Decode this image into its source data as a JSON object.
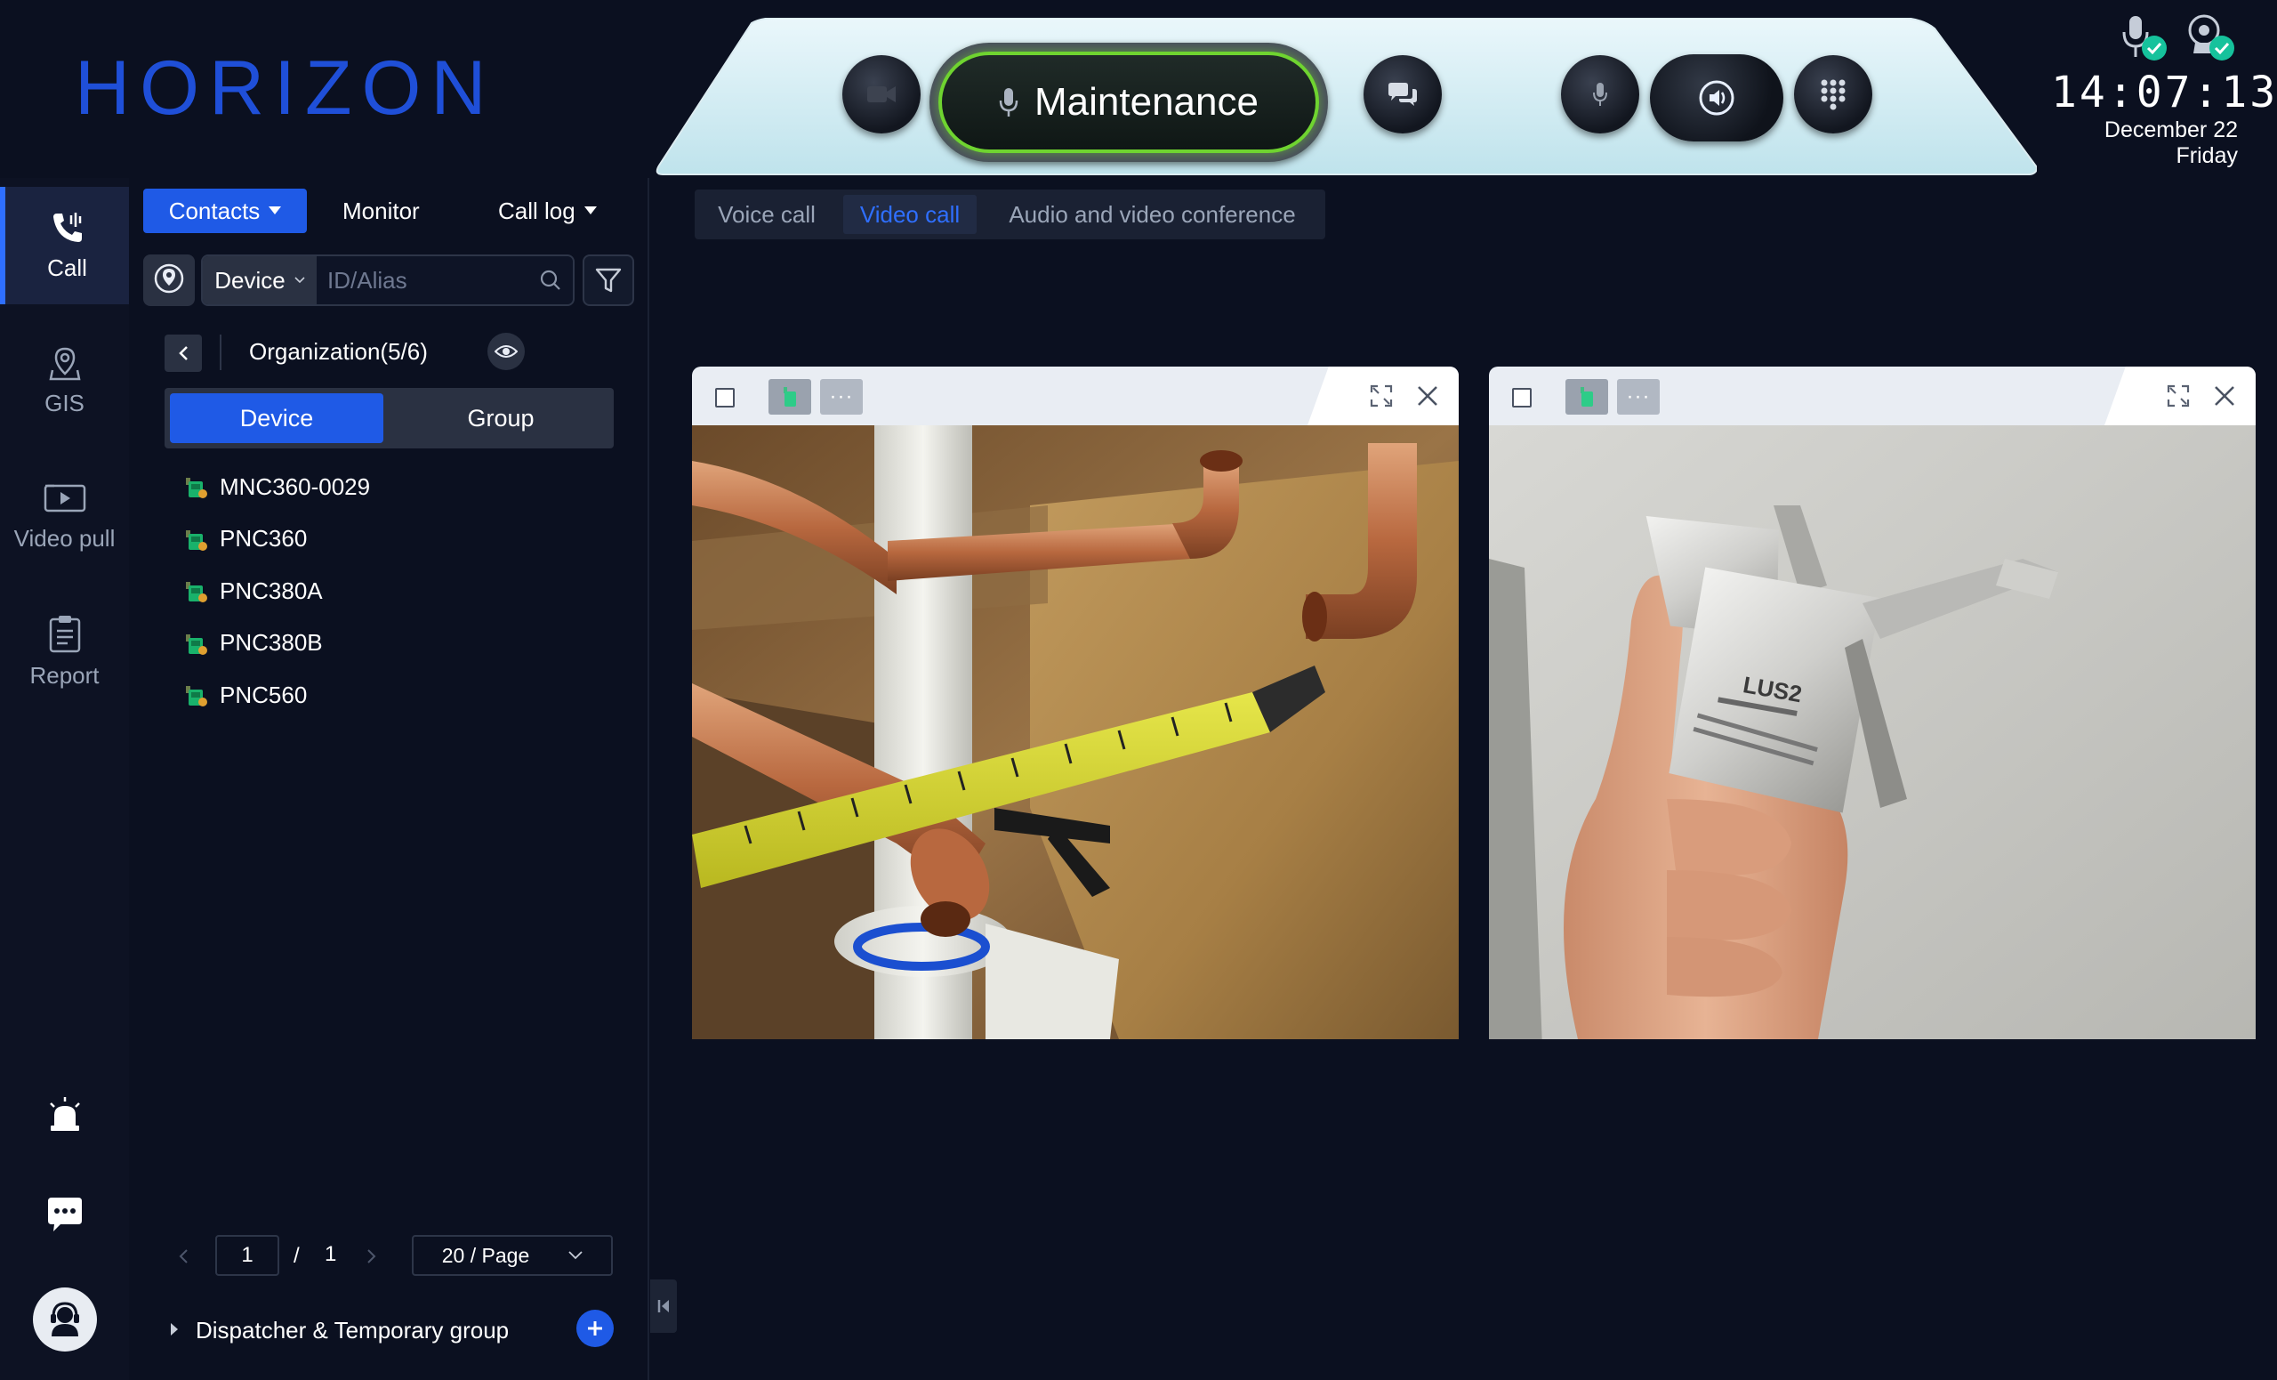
{
  "header": {
    "logo": "HORIZON",
    "ptt_label": "Maintenance",
    "clock": "14:07:13",
    "date": "December 22",
    "weekday": "Friday"
  },
  "nav": {
    "items": [
      {
        "label": "Call",
        "icon": "phone-wave-icon",
        "active": true
      },
      {
        "label": "GIS",
        "icon": "map-pin-icon",
        "active": false
      },
      {
        "label": "Video pull",
        "icon": "video-play-icon",
        "active": false
      },
      {
        "label": "Report",
        "icon": "clipboard-icon",
        "active": false
      }
    ],
    "bottom_icons": [
      "alarm-light-icon",
      "chat-bubble-icon",
      "headset-user-icon"
    ]
  },
  "panel": {
    "tabs": {
      "contacts": "Contacts",
      "monitor": "Monitor",
      "call_log": "Call log"
    },
    "search": {
      "scope": "Device",
      "placeholder": "ID/Alias"
    },
    "org_label": "Organization(5/6)",
    "segment": {
      "device": "Device",
      "group": "Group"
    },
    "devices": [
      "MNC360-0029",
      "PNC360",
      "PNC380A",
      "PNC380B",
      "PNC560"
    ],
    "pager": {
      "current": "1",
      "separator": "/",
      "total": "1",
      "page_size": "20 / Page"
    },
    "dispatcher_label": "Dispatcher & Temporary group"
  },
  "main": {
    "call_tabs": [
      {
        "label": "Voice call",
        "active": false
      },
      {
        "label": "Video call",
        "active": true
      },
      {
        "label": "Audio and video conference",
        "active": false
      }
    ],
    "video_windows": [
      {
        "content": "copper-pipes-and-tape-measure"
      },
      {
        "content": "hand-holding-metal-bracket"
      }
    ]
  },
  "colors": {
    "accent": "#1f5ae6",
    "ptt_ring": "#6fd430",
    "background": "#0b1020",
    "active_tab_text": "#2f6fff"
  }
}
